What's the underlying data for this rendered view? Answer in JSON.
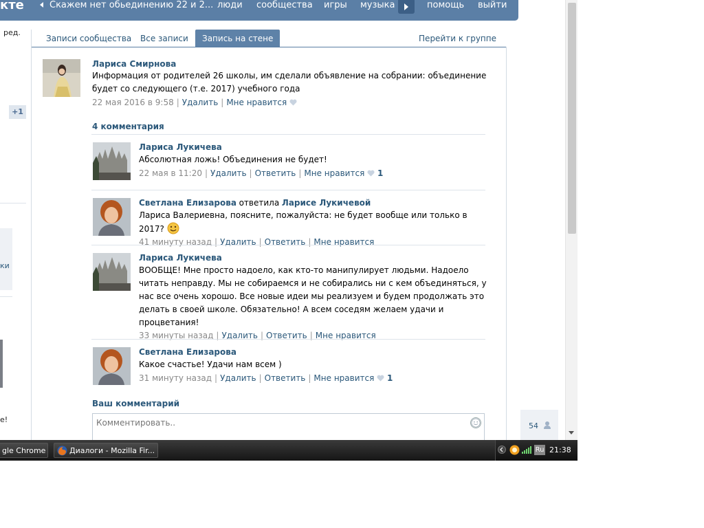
{
  "topbar": {
    "logo": "кте",
    "back_group": "Скажем нет обьединению 22 и 2...",
    "nav": [
      "люди",
      "сообщества",
      "игры",
      "музыка",
      "помощь",
      "выйти"
    ]
  },
  "sidebar": {
    "edit_text": "ред.",
    "plus_one": "+1",
    "partial_link": "ки",
    "partial_text": "е!"
  },
  "tabs": {
    "items": [
      "Записи сообщества",
      "Все записи",
      "Запись на стене"
    ],
    "active_index": 2,
    "group_link": "Перейти к группе"
  },
  "post": {
    "author": "Лариса Смирнова",
    "text": "Информация от родителей 26 школы, им сделали объявление на собрании: объединение будет со следующего (т.е. 2017) учебного года",
    "date": "22 мая 2016 в 9:58",
    "delete": "Удалить",
    "like": "Мне нравится"
  },
  "comments_header": "4 комментария",
  "comments": [
    {
      "author": "Лариса Лукичева",
      "reply_word": "",
      "reply_to": "",
      "text": "Абсолютная ложь! Объединения не будет!",
      "date": "22 мая в 11:20",
      "delete": "Удалить",
      "reply": "Ответить",
      "like": "Мне нравится",
      "likes": "1"
    },
    {
      "author": "Светлана Елизарова",
      "reply_word": "ответила",
      "reply_to": "Ларисе Лукичевой",
      "text": "Лариса Валериевна, поясните, пожалуйста: не будет вообще или только в 2017?",
      "date": "41 минуту назад",
      "delete": "Удалить",
      "reply": "Ответить",
      "like": "Мне нравится",
      "likes": ""
    },
    {
      "author": "Лариса Лукичева",
      "reply_word": "",
      "reply_to": "",
      "text": "ВООБЩЕ! Мне просто надоело, как кто-то манипулирует людьми. Надоело читать неправду. Мы не собираемся и не собирались ни с кем объединяться, у нас все очень хорошо. Все новые идеи мы реализуем и будем продолжать это делать в своей школе. Обязательно! А всем соседям желаем удачи и процветания!",
      "date": "33 минуты назад",
      "delete": "Удалить",
      "reply": "Ответить",
      "like": "Мне нравится",
      "likes": ""
    },
    {
      "author": "Светлана Елизарова",
      "reply_word": "",
      "reply_to": "",
      "text": "Какое счастье! Удачи нам всем )",
      "date": "31 минуту назад",
      "delete": "Удалить",
      "reply": "Ответить",
      "like": "Мне нравится",
      "likes": "1"
    }
  ],
  "your_comment": {
    "label": "Ваш комментарий",
    "placeholder": "Комментировать.."
  },
  "online_count": "54",
  "taskbar": {
    "tasks": [
      "gle Chrome",
      "Диалоги - Mozilla Fir..."
    ],
    "lang": "Ru",
    "clock": "21:38"
  },
  "colors": {
    "header_bg": "#5b7fa6",
    "link": "#2b587a",
    "active_tab": "#5e82a8",
    "muted": "#888888"
  }
}
